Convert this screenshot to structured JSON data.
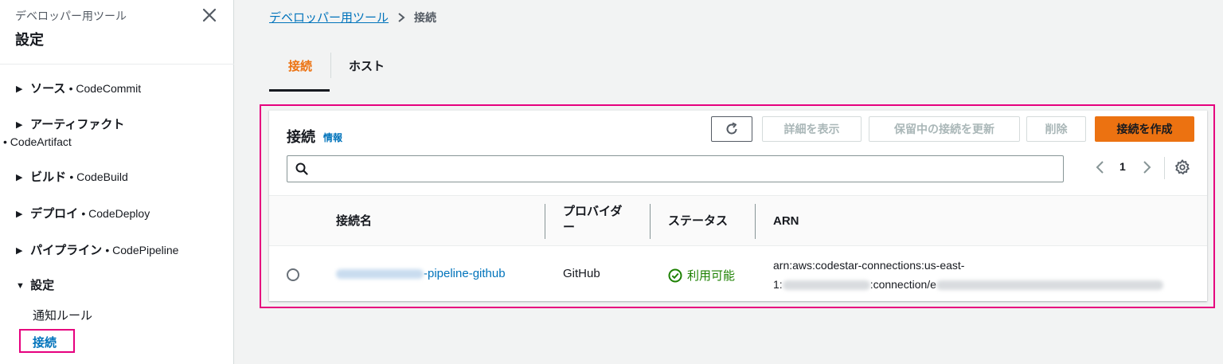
{
  "sidebar": {
    "subtitle": "デベロッパー用ツール",
    "title": "設定",
    "groups": [
      {
        "name": "ソース",
        "service": "• CodeCommit"
      },
      {
        "name": "アーティファクト",
        "service": "• CodeArtifact"
      },
      {
        "name": "ビルド",
        "service": "• CodeBuild"
      },
      {
        "name": "デプロイ",
        "service": "• CodeDeploy"
      },
      {
        "name": "パイプライン",
        "service": "• CodePipeline"
      },
      {
        "name": "設定",
        "service": ""
      }
    ],
    "items": [
      {
        "label": "通知ルール"
      },
      {
        "label": "接続"
      }
    ]
  },
  "breadcrumb": {
    "parent": "デベロッパー用ツール",
    "current": "接続"
  },
  "tabs": [
    {
      "label": "接続"
    },
    {
      "label": "ホスト"
    }
  ],
  "panel": {
    "title": "接続",
    "info": "情報",
    "buttons": {
      "details": "詳細を表示",
      "update": "保留中の接続を更新",
      "delete": "削除",
      "create": "接続を作成"
    },
    "search_placeholder": "",
    "page": "1"
  },
  "table": {
    "columns": [
      "接続名",
      "プロバイダー",
      "ステータス",
      "ARN"
    ],
    "rows": [
      {
        "name_suffix": "-pipeline-github",
        "provider": "GitHub",
        "status": "利用可能",
        "arn_line1": "arn:aws:codestar-connections:us-east-",
        "arn_prefix": "1:",
        "arn_mid": ":connection/e"
      }
    ]
  },
  "colors": {
    "accent": "#ec7211",
    "link": "#0073bb",
    "success": "#1d8102",
    "highlight": "#e6007e"
  }
}
